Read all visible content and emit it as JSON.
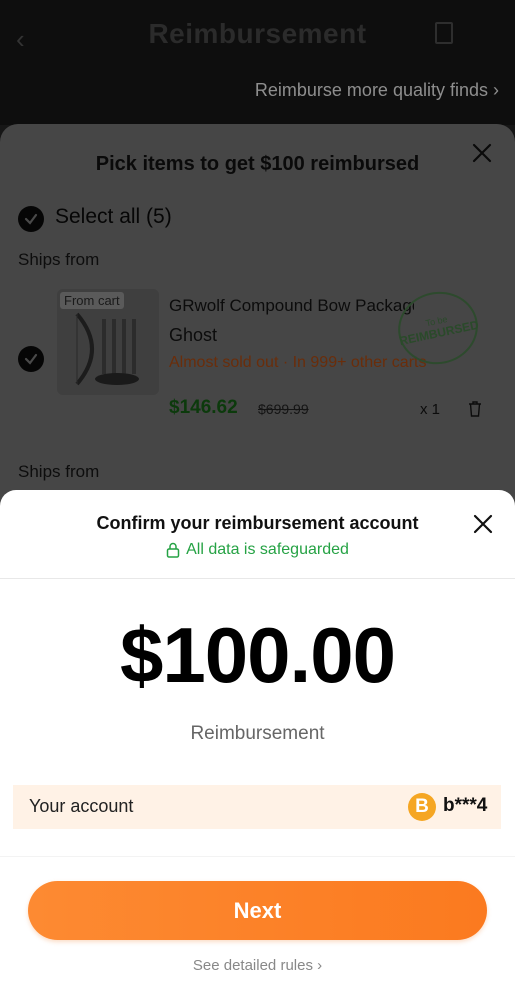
{
  "header": {
    "title": "Reimbursement",
    "link": "Reimburse more quality finds ›"
  },
  "pick_sheet": {
    "title": "Pick items to get $100 reimbursed",
    "select_all": "Select all (5)",
    "ships_from_1": "Ships from",
    "ships_from_2": "Ships from",
    "item": {
      "thumb_tag": "From cart",
      "name": "GRwolf Compound Bow Package",
      "variant": "Ghost",
      "stock_note": "Almost sold out · In 999+ other carts",
      "price": "$146.62",
      "original_price": "$699.99",
      "quantity": "x 1",
      "stamp_top": "To be",
      "stamp_main": "REIMBURSED"
    }
  },
  "confirm": {
    "title": "Confirm your reimbursement account",
    "safeguard": "All data is safeguarded",
    "amount": "$100.00",
    "amount_label": "Reimbursement",
    "account_label": "Your account",
    "account_icon": "B",
    "account_value": "b***4",
    "next_label": "Next",
    "rules_link": "See detailed rules ›"
  },
  "colors": {
    "accent_orange": "#fb7a1f",
    "safe_green": "#25a244",
    "account_bg": "#fff2e6"
  }
}
